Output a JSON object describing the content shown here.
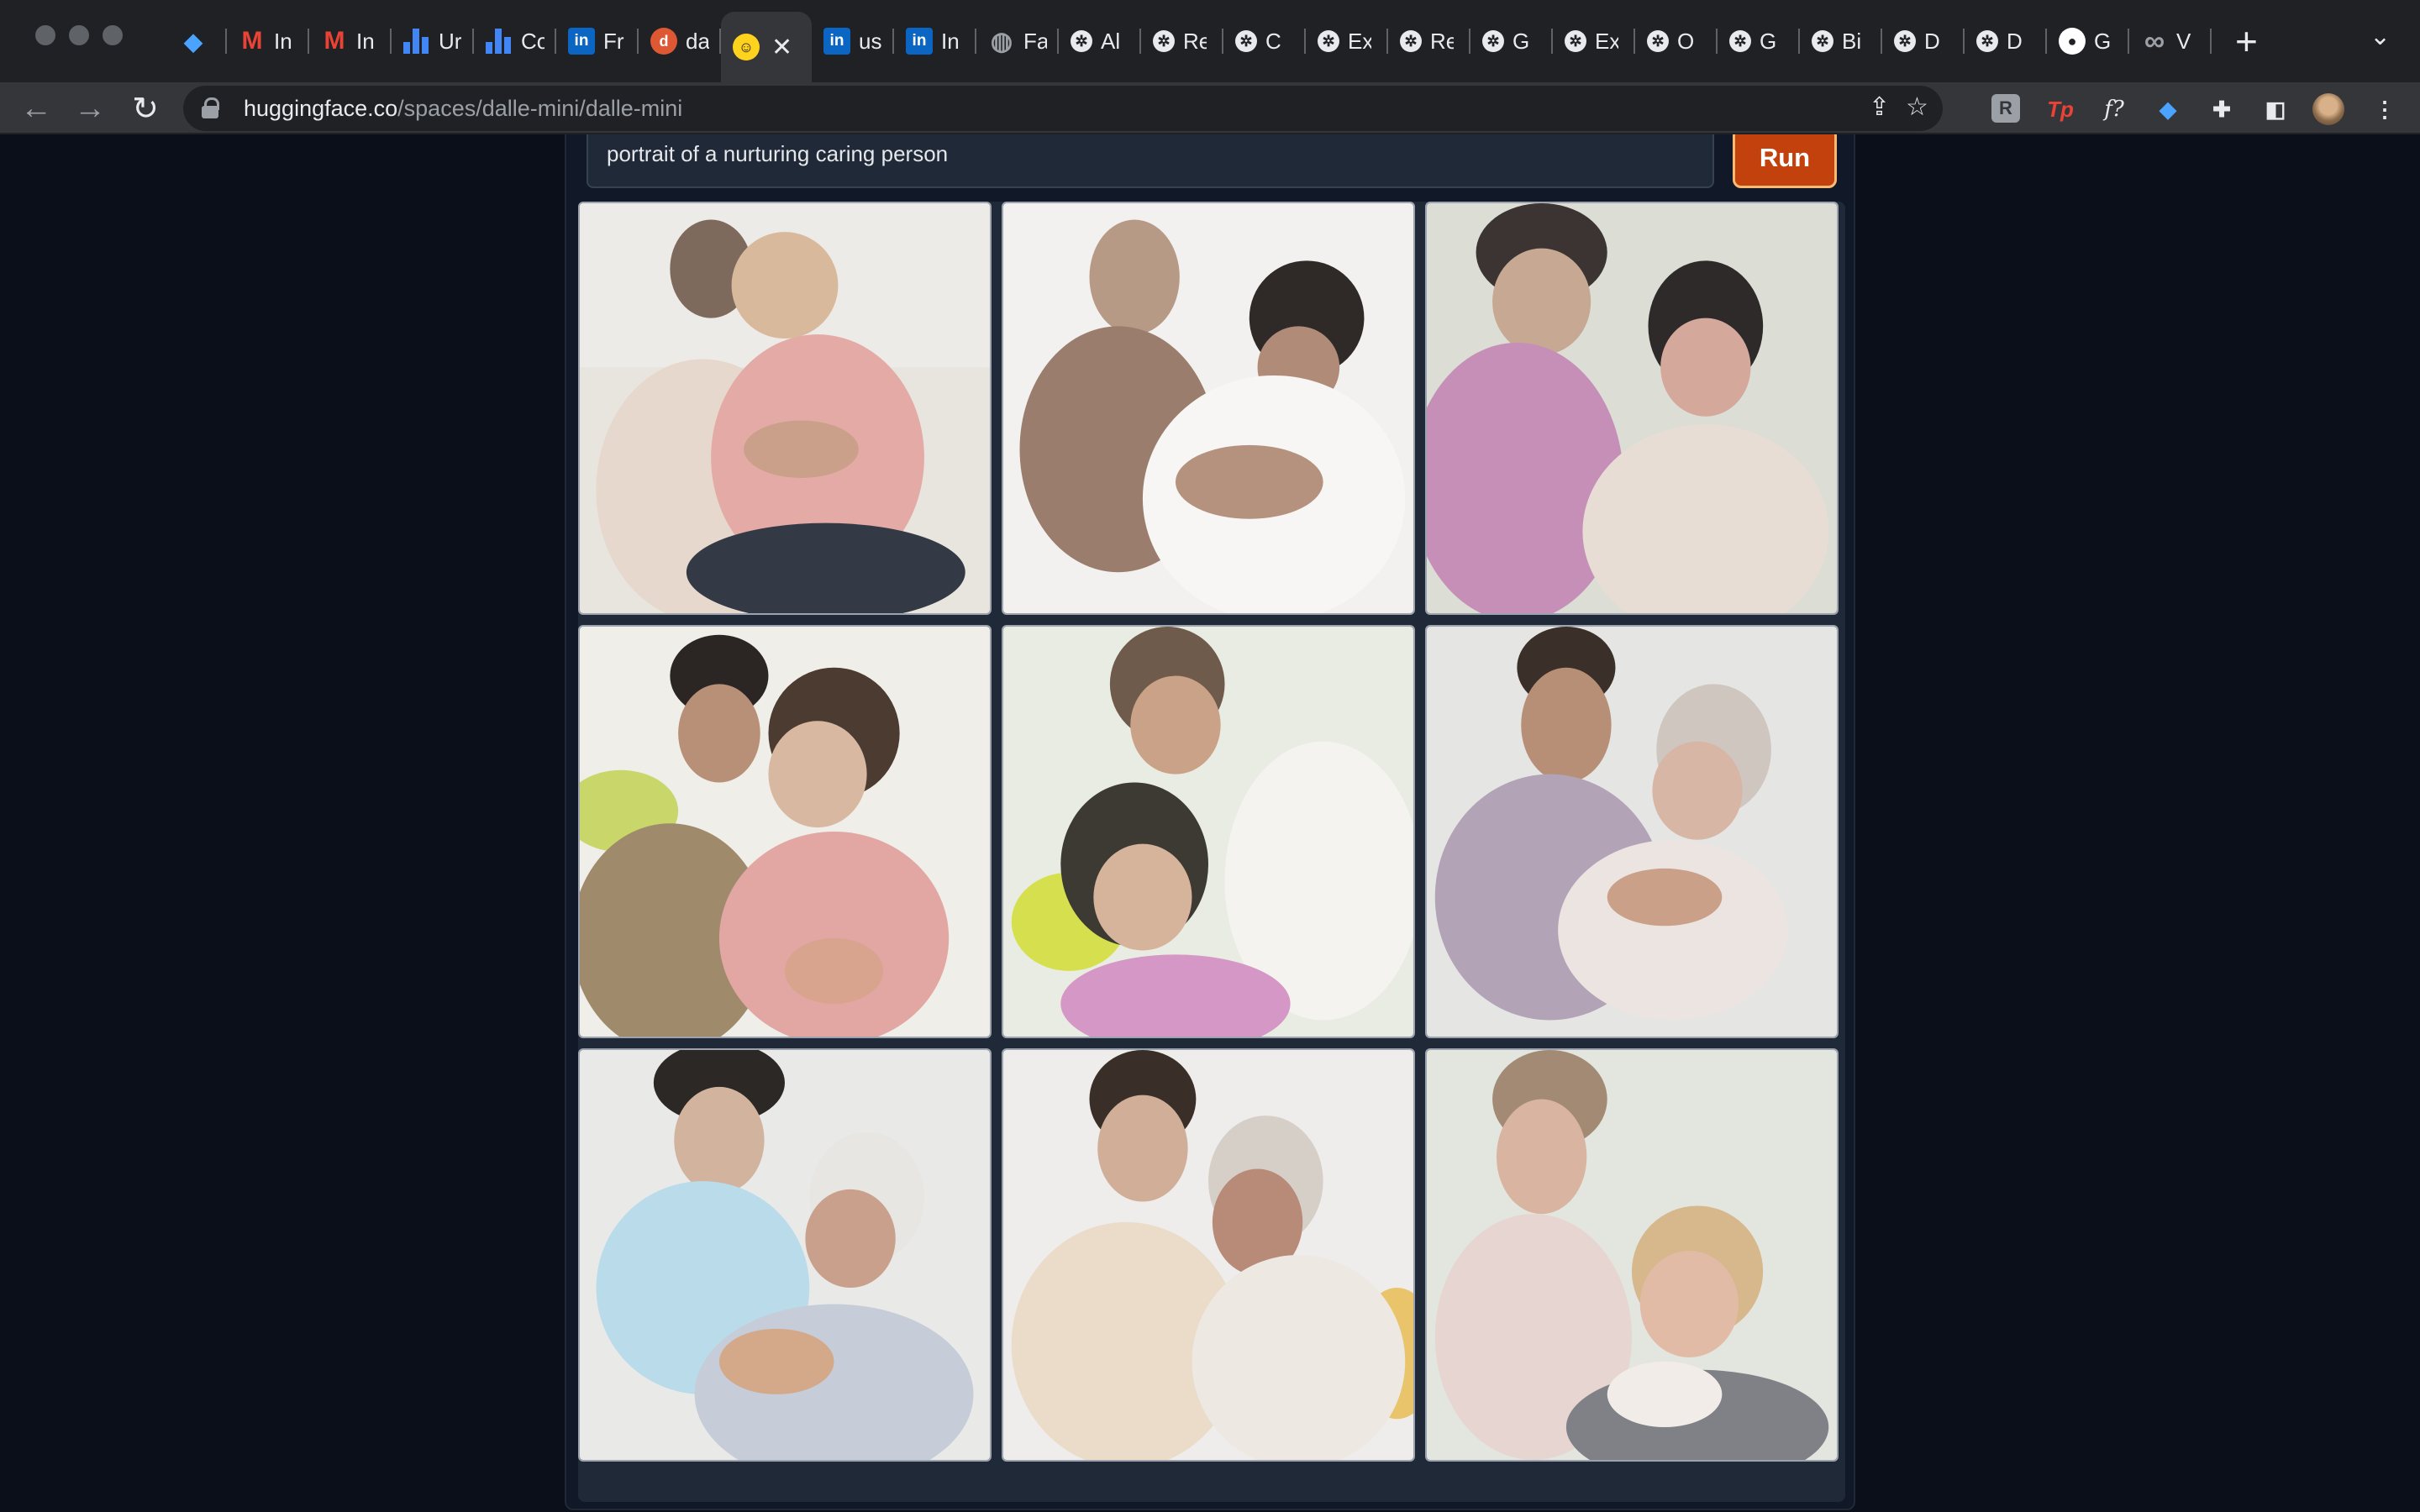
{
  "browser": {
    "tabs": [
      {
        "icon": "gem-icon",
        "title": ""
      },
      {
        "icon": "gmail-icon",
        "title": "In"
      },
      {
        "icon": "gmail-icon",
        "title": "In"
      },
      {
        "icon": "analytics-icon",
        "title": "Ur"
      },
      {
        "icon": "analytics-icon",
        "title": "Co"
      },
      {
        "icon": "linkedin-icon",
        "title": "Fr"
      },
      {
        "icon": "duckduckgo-icon",
        "title": "da"
      },
      {
        "icon": "huggingface-icon",
        "title": ""
      },
      {
        "icon": "linkedin-icon",
        "title": "us"
      },
      {
        "icon": "linkedin-icon",
        "title": "In"
      },
      {
        "icon": "globe-icon",
        "title": "Fa"
      },
      {
        "icon": "gear-icon",
        "title": "Al"
      },
      {
        "icon": "gear-icon",
        "title": "Re"
      },
      {
        "icon": "gear-icon",
        "title": "C"
      },
      {
        "icon": "gear-icon",
        "title": "Ex"
      },
      {
        "icon": "gear-icon",
        "title": "Re"
      },
      {
        "icon": "gear-icon",
        "title": "G"
      },
      {
        "icon": "gear-icon",
        "title": "Ex"
      },
      {
        "icon": "gear-icon",
        "title": "O"
      },
      {
        "icon": "gear-icon",
        "title": "G"
      },
      {
        "icon": "gear-icon",
        "title": "Bi"
      },
      {
        "icon": "gear-icon",
        "title": "D"
      },
      {
        "icon": "gear-icon",
        "title": "D"
      },
      {
        "icon": "github-icon",
        "title": "G"
      },
      {
        "icon": "infinity-icon",
        "title": "V"
      }
    ],
    "active_tab_index": 7,
    "url_host": "huggingface.co",
    "url_path": "/spaces/dalle-mini/dalle-mini"
  },
  "app": {
    "prompt_text": "portrait of a nurturing caring person",
    "run_label": "Run",
    "accent_color": "#c2410c",
    "result_images": [
      "generated-image-1",
      "generated-image-2",
      "generated-image-3",
      "generated-image-4",
      "generated-image-5",
      "generated-image-6",
      "generated-image-7",
      "generated-image-8",
      "generated-image-9"
    ]
  }
}
